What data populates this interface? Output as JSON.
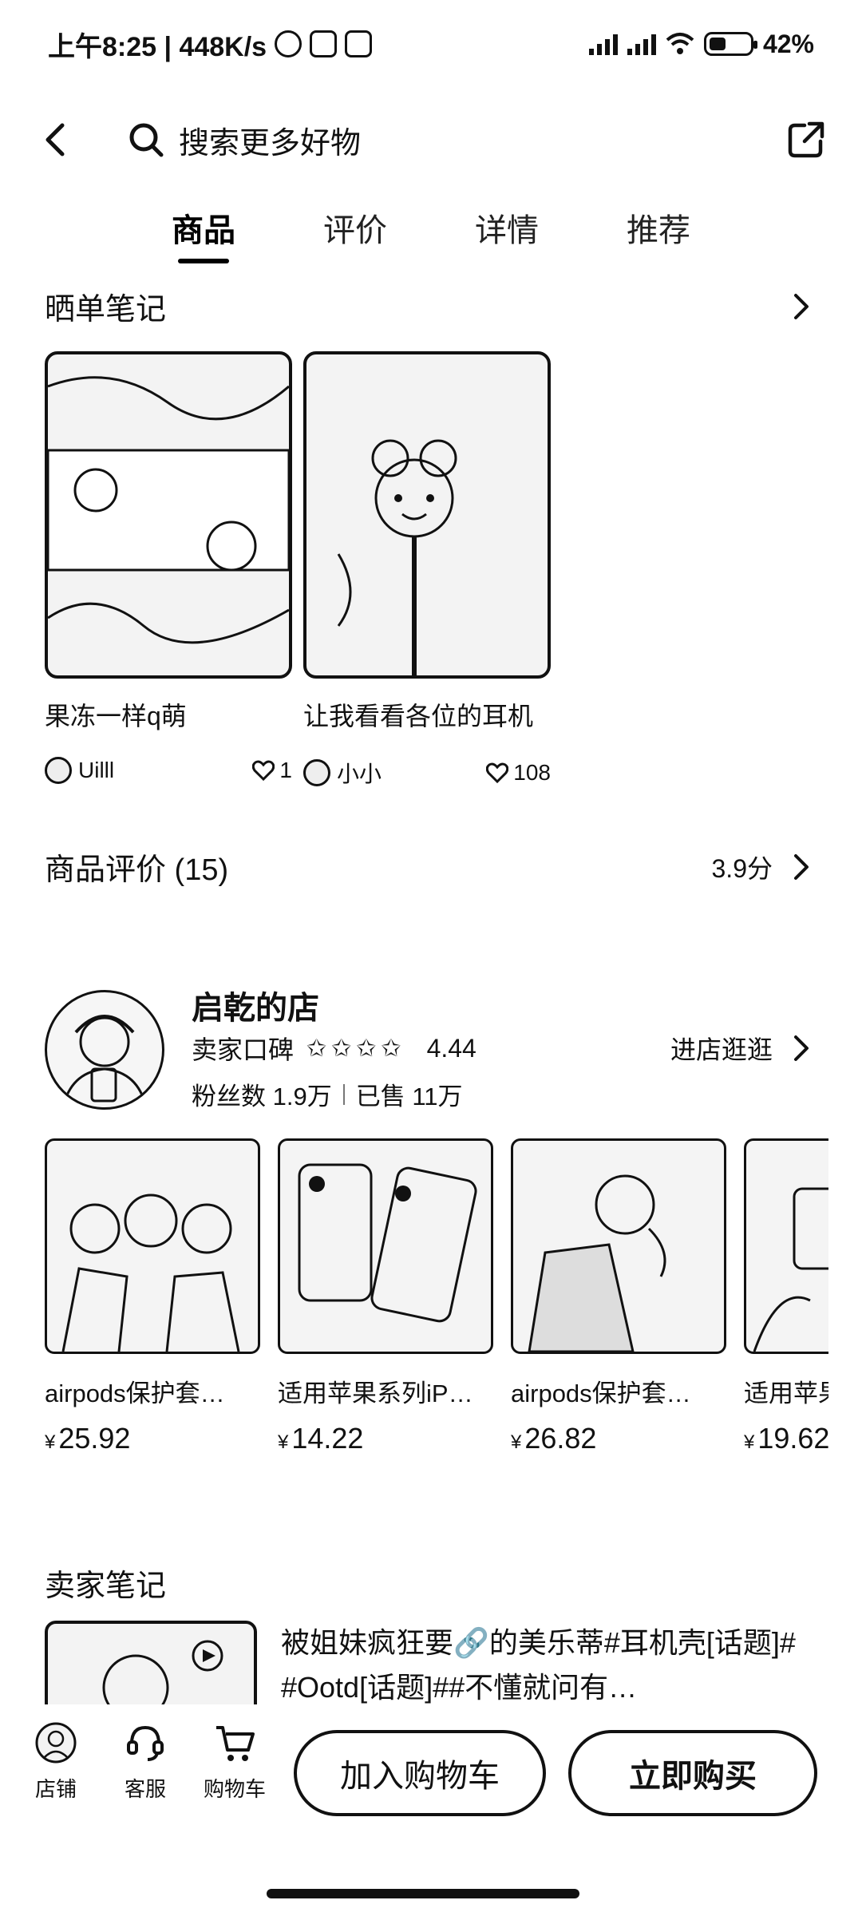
{
  "status_bar": {
    "time": "上午8:25 | 448K/s",
    "battery": "42%",
    "battery_level": 0.42
  },
  "topnav": {
    "search_placeholder": "搜索更多好物"
  },
  "tabs": [
    {
      "label": "商品",
      "active": true
    },
    {
      "label": "评价"
    },
    {
      "label": "详情"
    },
    {
      "label": "推荐"
    }
  ],
  "notes_section": {
    "title": "晒单笔记",
    "items": [
      {
        "title": "果冻一样q萌",
        "user": "Uilll",
        "likes": "1"
      },
      {
        "title": "让我看看各位的耳机",
        "user": "小小",
        "likes": "108"
      }
    ]
  },
  "reviews_section": {
    "title": "商品评价 (15)",
    "score": "3.9分"
  },
  "shop": {
    "name": "启乾的店",
    "rating_label": "卖家口碑",
    "stars": "✩✩✩✩",
    "rating": "4.44",
    "followers": "粉丝数 1.9万",
    "sold": "已售 11万",
    "enter_label": "进店逛逛"
  },
  "products": [
    {
      "name": "airpods保护套…",
      "price": "25.92"
    },
    {
      "name": "适用苹果系列iP…",
      "price": "14.22"
    },
    {
      "name": "airpods保护套…",
      "price": "26.82"
    },
    {
      "name": "适用苹果",
      "price": "19.62"
    }
  ],
  "currency_symbol": "¥",
  "seller_notes": {
    "title": "卖家笔记",
    "text": "被姐妹疯狂要🔗的美乐蒂#耳机壳[话题]#  #Ootd[话题]##不懂就问有…"
  },
  "bottom_bar": {
    "shop_label": "店铺",
    "service_label": "客服",
    "cart_label": "购物车",
    "add_cart_label": "加入购物车",
    "buy_label": "立即购买"
  }
}
